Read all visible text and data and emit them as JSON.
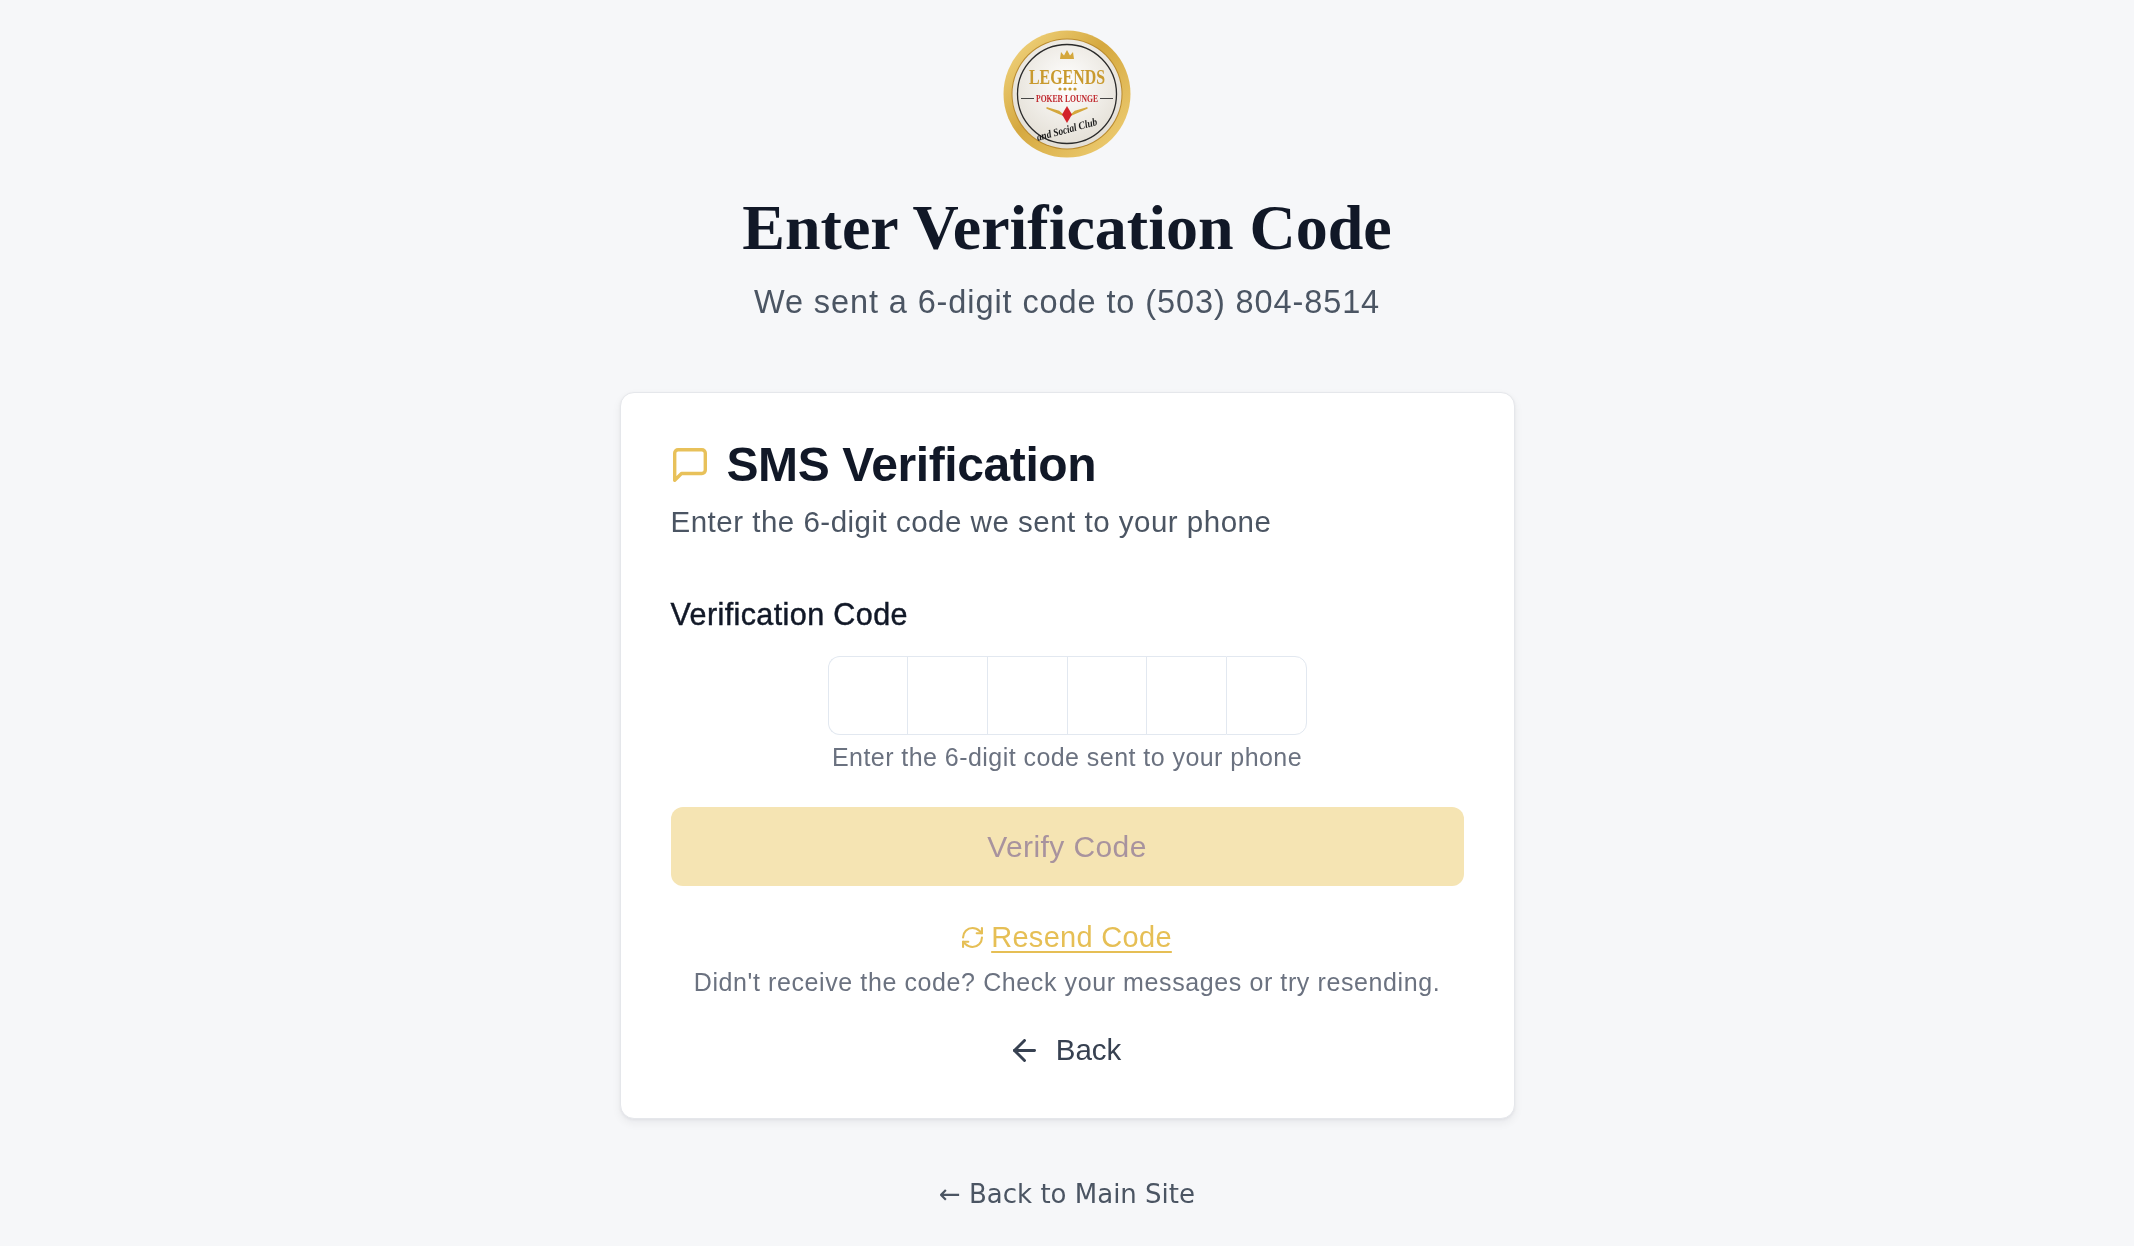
{
  "logo": {
    "wordmark": "LEGENDS",
    "tagline": "POKER LOUNGE",
    "script": "and Social Club"
  },
  "header": {
    "title": "Enter Verification Code",
    "subtitle": "We sent a 6-digit code to (503) 804-8514"
  },
  "card": {
    "title": "SMS Verification",
    "description": "Enter the 6-digit code we sent to your phone",
    "code_field": {
      "label": "Verification Code",
      "cells": [
        {
          "focused": false
        },
        {
          "focused": false
        },
        {
          "focused": false
        },
        {
          "focused": false
        },
        {
          "focused": false
        },
        {
          "focused": false
        }
      ],
      "hint": "Enter the 6-digit code sent to your phone"
    },
    "verify_button": {
      "label": "Verify Code",
      "disabled": true
    },
    "resend_link": {
      "label": "Resend Code"
    },
    "resend_note": "Didn't receive the code? Check your messages or try resending.",
    "back_button": {
      "label": "Back"
    }
  },
  "footer_link": {
    "label": "← Back to Main Site"
  }
}
